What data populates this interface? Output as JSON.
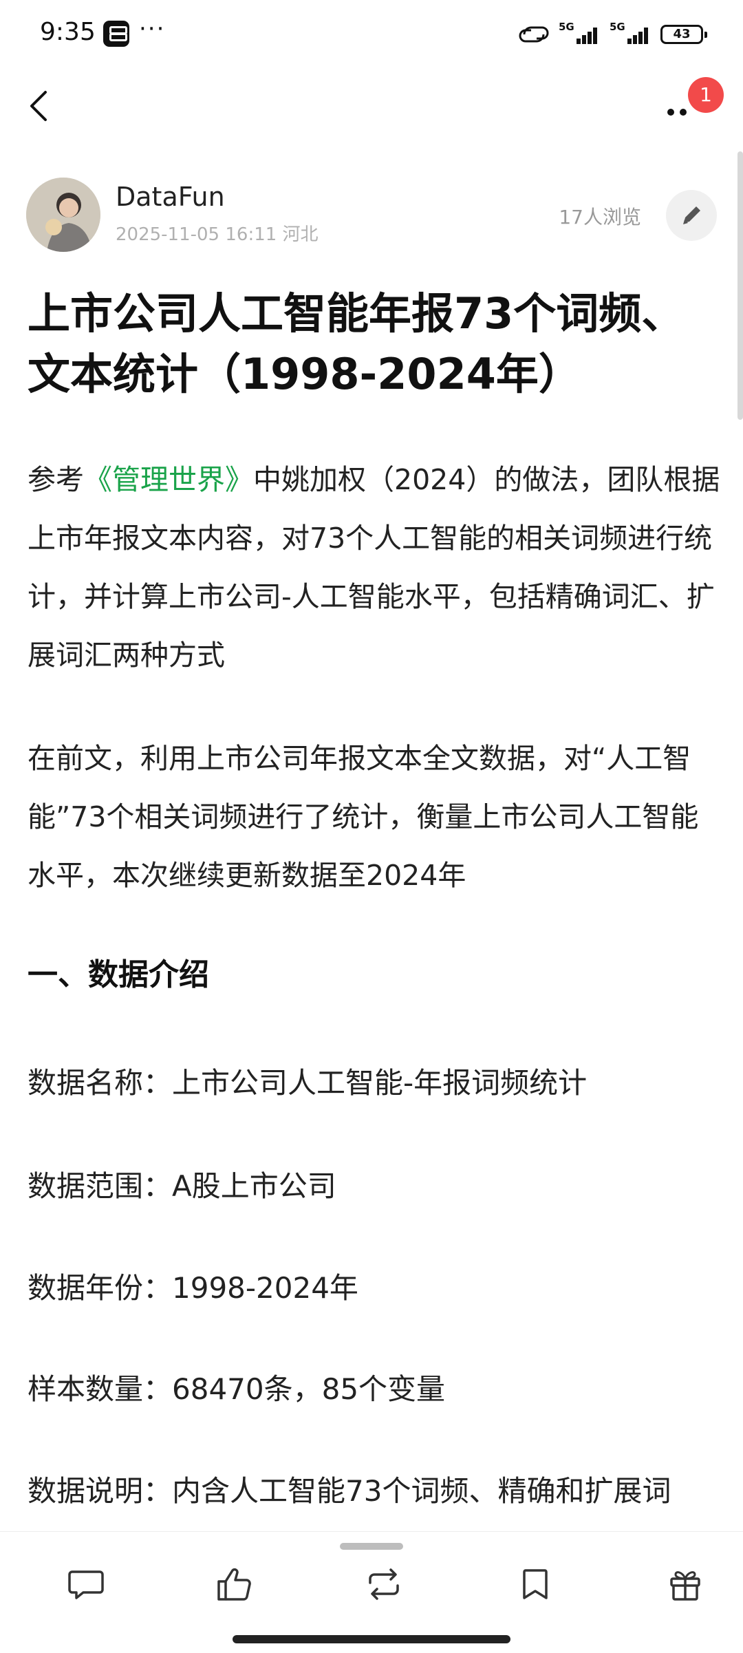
{
  "status_bar": {
    "time": "9:35",
    "network1": "5G",
    "network2": "5G",
    "battery": "43",
    "icons": [
      "capcut-icon",
      "hd-voice-icon",
      "signal-icon",
      "battery-icon"
    ]
  },
  "nav": {
    "notification_badge": "1",
    "icons": [
      "back-arrow-icon",
      "more-dots-icon"
    ]
  },
  "author": {
    "name": "DataFun",
    "meta": "2025-11-05 16:11  河北",
    "views": "17人浏览"
  },
  "article": {
    "title": "上市公司人工智能年报73个词频、文本统计（1998-2024年）",
    "para1_prefix": "参考",
    "para1_link": "《管理世界》",
    "para1_rest": "中姚加权（2024）的做法，团队根据上市年报文本内容，对73个人工智能的相关词频进行统计，并计算上市公司-人工智能水平，包括精确词汇、扩展词汇两种方式",
    "para2": "在前文，利用上市公司年报文本全文数据，对“人工智能”73个相关词频进行了统计，衡量上市公司人工智能水平，本次继续更新数据至2024年",
    "section_heading": "一、数据介绍",
    "info_lines": [
      "数据名称：上市公司人工智能-年报词频统计",
      "数据范围：A股上市公司",
      "数据年份：1998-2024年",
      "样本数量：68470条，85个变量",
      "数据说明：内含人工智能73个词频、精确和扩展词"
    ]
  },
  "toolbar": {
    "icons": [
      "comment-icon",
      "like-icon",
      "repost-icon",
      "bookmark-icon",
      "gift-icon"
    ]
  },
  "colors": {
    "link_green": "#1aa34a",
    "badge_red": "#f24a4a"
  }
}
